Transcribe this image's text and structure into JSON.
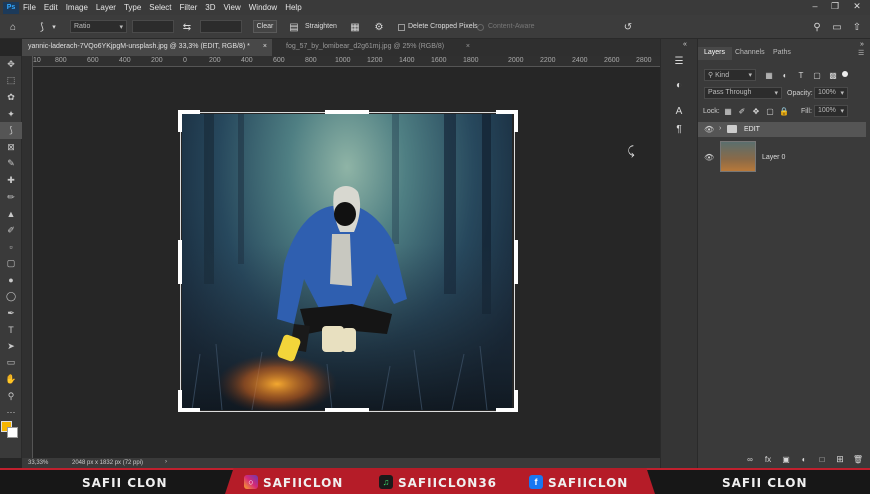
{
  "menu": {
    "logo": "Ps",
    "items": [
      "File",
      "Edit",
      "Image",
      "Layer",
      "Type",
      "Select",
      "Filter",
      "3D",
      "View",
      "Window",
      "Help"
    ]
  },
  "options": {
    "ratio": "Ratio",
    "clear": "Clear",
    "straighten": "Straighten",
    "delete_cropped": "Delete Cropped Pixels",
    "content_aware": "Content-Aware"
  },
  "tabs": [
    {
      "label": "yannic-laderach-7VQo6YKjpgM-unsplash.jpg @ 33,3% (EDIT, RGB/8) *"
    },
    {
      "label": "fog_57_by_lomibear_d2g61mj.jpg @ 25% (RGB/8)"
    }
  ],
  "ruler": [
    "10",
    "800",
    "600",
    "400",
    "200",
    "0",
    "200",
    "400",
    "600",
    "800",
    "1000",
    "1200",
    "1400",
    "1600",
    "1800",
    "2000",
    "2200",
    "2400",
    "2600",
    "2800"
  ],
  "status": {
    "zoom": "33,33%",
    "size": "2048 px x 1832 px (72 ppi)"
  },
  "layers_panel": {
    "tabs": [
      "Layers",
      "Channels",
      "Paths"
    ],
    "filter": "Kind",
    "blend_mode": "Pass Through",
    "opacity_label": "Opacity:",
    "opacity": "100%",
    "lock_label": "Lock:",
    "fill_label": "Fill:",
    "fill": "100%",
    "layers": [
      {
        "name": "EDIT",
        "type": "group"
      },
      {
        "name": "Layer 0",
        "type": "image"
      }
    ]
  },
  "banner": {
    "left": "SAFII CLON",
    "instagram": "SAFIICLON",
    "tiktok": "SAFIICLON36",
    "facebook": "SAFIICLON",
    "right": "SAFII CLON",
    "accent": "#c0202e"
  }
}
